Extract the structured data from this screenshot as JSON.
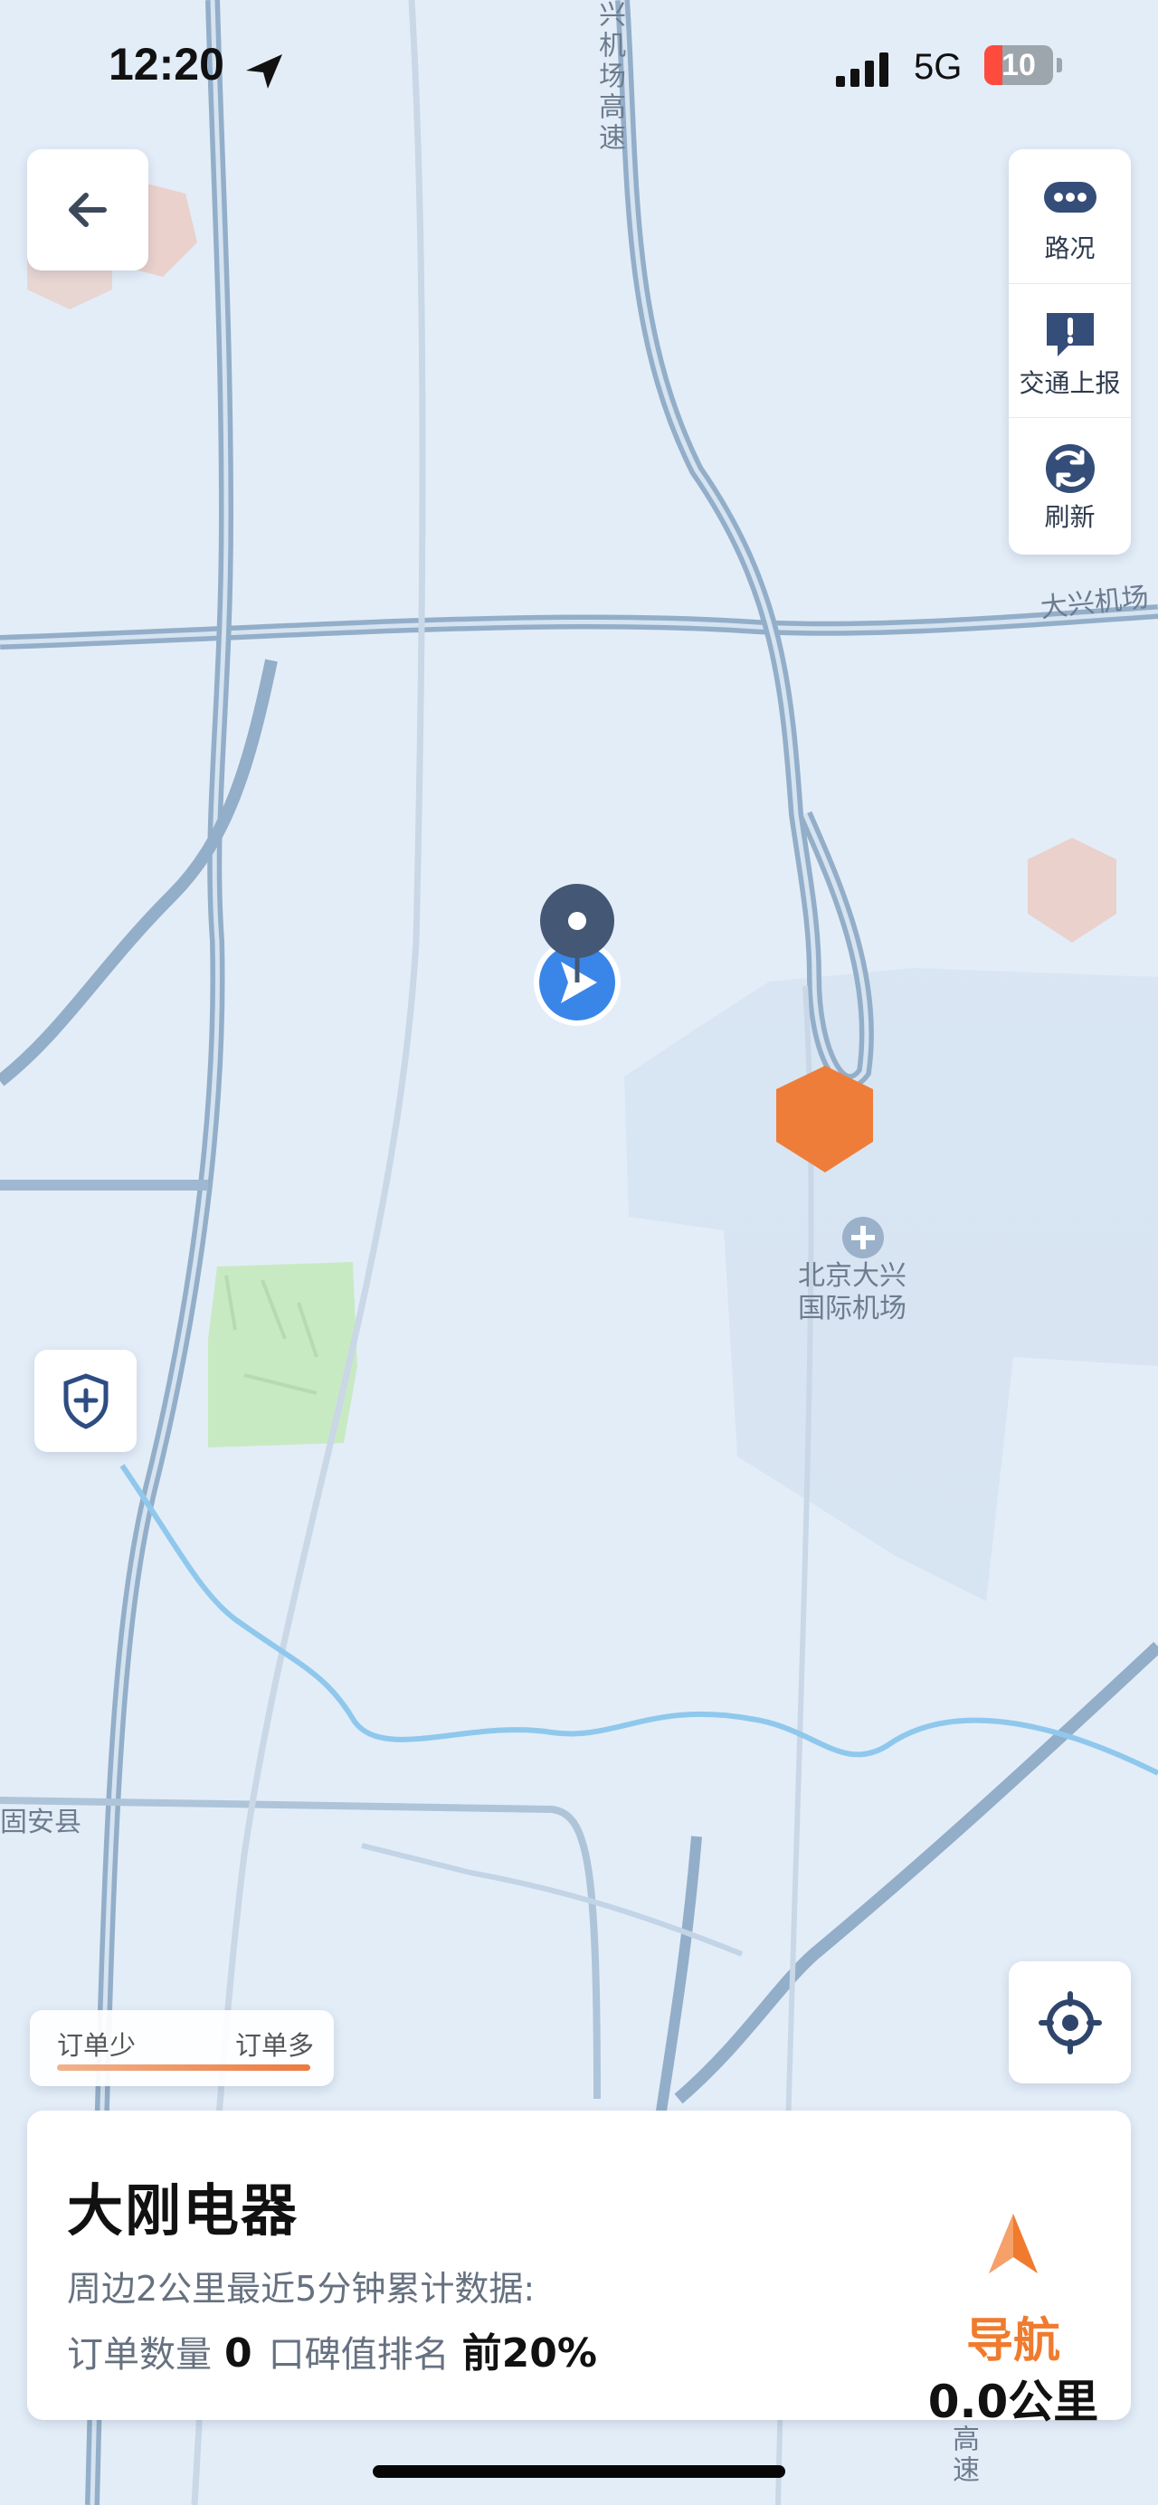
{
  "status_bar": {
    "time": "12:20",
    "network": "5G",
    "battery": "10"
  },
  "map": {
    "labels": {
      "airport_expressway": "兴机场高速",
      "daxing_airport_road": "大兴机场",
      "airport_name_line1": "北京大兴",
      "airport_name_line2": "国际机场",
      "guan_county": "固安县",
      "bottom_speed": "高速"
    }
  },
  "toolbar": {
    "items": [
      {
        "label": "路况",
        "icon": "traffic-icon"
      },
      {
        "label": "交通上报",
        "icon": "report-icon"
      },
      {
        "label": "刷新",
        "icon": "refresh-icon"
      }
    ]
  },
  "legend": {
    "low": "订单少",
    "high": "订单多"
  },
  "info_card": {
    "title": "大刚电器",
    "subtitle": "周边2公里最近5分钟累计数据:",
    "order_count_label": "订单数量",
    "order_count_value": "0",
    "rating_rank_label": "口碑值排名",
    "rating_rank_value": "前20%",
    "navigation_label": "导航",
    "distance": "0.0公里"
  },
  "colors": {
    "hot_area": "#ef7d3a",
    "light_hot_area": "#eacdc6",
    "route_blue": "#3a86e8"
  }
}
